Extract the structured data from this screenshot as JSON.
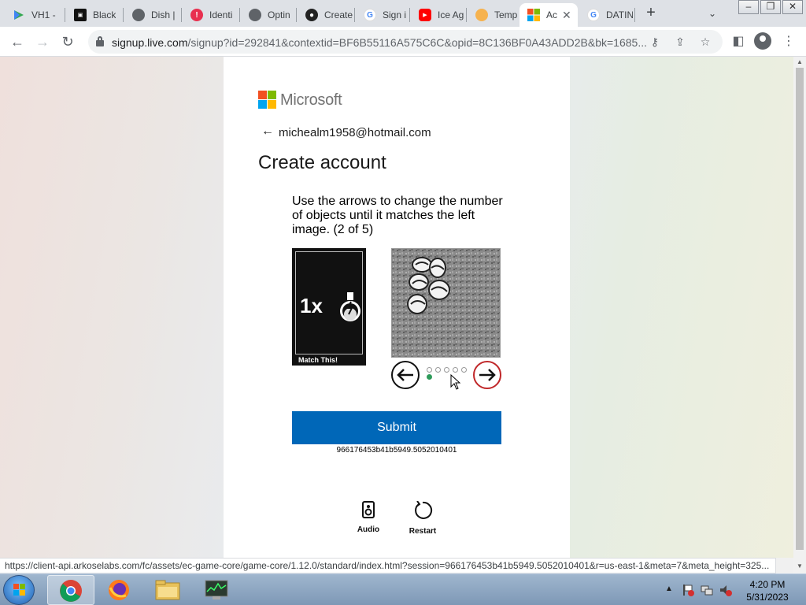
{
  "browser": {
    "tabs": [
      {
        "label": "VH1 -",
        "icon": "google-play-icon",
        "color": "#34a853"
      },
      {
        "label": "Black",
        "icon": "blackbook-icon",
        "color": "#111111"
      },
      {
        "label": "Dish |",
        "icon": "globe-icon",
        "color": "#5f6368"
      },
      {
        "label": "Identi",
        "icon": "identity-icon",
        "color": "#e8304f"
      },
      {
        "label": "Optin",
        "icon": "globe-icon",
        "color": "#5f6368"
      },
      {
        "label": "Create",
        "icon": "create-icon",
        "color": "#222222"
      },
      {
        "label": "Sign i",
        "icon": "google-icon",
        "color": "#4285f4"
      },
      {
        "label": "Ice Ag",
        "icon": "youtube-icon",
        "color": "#ff0000"
      },
      {
        "label": "Temp",
        "icon": "temp-mail-icon",
        "color": "#f6b24e"
      },
      {
        "label": "Ac",
        "icon": "microsoft-icon",
        "color": "#f25022",
        "active": true
      },
      {
        "label": "DATIN",
        "icon": "google-icon",
        "color": "#4285f4"
      }
    ],
    "tab_close": "✕",
    "new_tab": "+",
    "url_host": "signup.live.com",
    "url_path": "/signup?id=292841&contextid=BF6B55116A575C6C&opid=8C136BF0A43ADD2B&bk=1685...",
    "status_url": "https://client-api.arkoselabs.com/fc/assets/ec-game-core/game-core/1.12.0/standard/index.html?session=966176453b41b5949.5052010401&r=us-east-1&meta=7&meta_height=325..."
  },
  "page": {
    "brand": "Microsoft",
    "identity": "michealm1958@hotmail.com",
    "title": "Create account",
    "instruction": "Use the arrows to change the number of objects until it matches the left image. (2 of 5)",
    "match_count": "1x",
    "match_caption": "Match This!",
    "dot_count": 5,
    "active_dot": 1,
    "submit_label": "Submit",
    "session_id": "966176453b41b5949.5052010401",
    "audio_label": "Audio",
    "restart_label": "Restart"
  },
  "taskbar": {
    "apps": [
      "chrome-icon",
      "firefox-icon",
      "file-explorer-icon",
      "task-manager-icon"
    ],
    "time": "4:20 PM",
    "date": "5/31/2023"
  },
  "colors": {
    "accent": "#0067b8",
    "ms_red": "#f25022",
    "ms_green": "#7fba00",
    "ms_blue": "#00a4ef",
    "ms_yellow": "#ffb900"
  }
}
